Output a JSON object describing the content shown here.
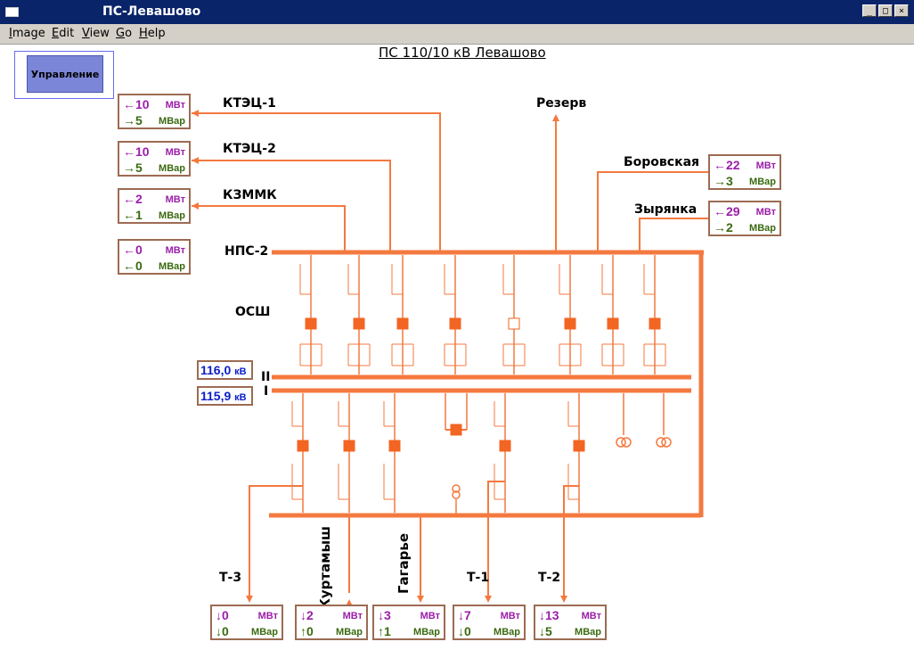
{
  "window": {
    "title": "ПС-Левашово"
  },
  "menu": [
    "Image",
    "Edit",
    "View",
    "Go",
    "Help"
  ],
  "control_button": "Управление",
  "page_title": "ПС 110/10 кВ Левашово",
  "labels": {
    "ktec1": "КТЭЦ-1",
    "ktec2": "КТЭЦ-2",
    "kzmmk": "КЗММК",
    "nps2": "НПС-2",
    "osh": "ОСШ",
    "rezerv": "Резерв",
    "borovskaya": "Боровская",
    "zyryanka": "Зырянка",
    "bus2": "II",
    "bus1": "I",
    "t3": "Т-3",
    "kurtamysh": "Куртамыш",
    "gagarye": "Гагарье",
    "t1": "Т-1",
    "t2": "Т-2"
  },
  "units": {
    "mw": "МВт",
    "mvar": "МВар",
    "kv": "кВ"
  },
  "voltages": {
    "bus2": "116,0",
    "bus1": "115,9"
  },
  "power": {
    "ktec1": {
      "p_arrow": "←",
      "p": "10",
      "q_arrow": "→",
      "q": "5"
    },
    "ktec2": {
      "p_arrow": "←",
      "p": "10",
      "q_arrow": "→",
      "q": "5"
    },
    "kzmmk": {
      "p_arrow": "←",
      "p": "2",
      "q_arrow": "←",
      "q": "1"
    },
    "nps2": {
      "p_arrow": "←",
      "p": "0",
      "q_arrow": "←",
      "q": "0"
    },
    "borovskaya": {
      "p_arrow": "←",
      "p": "22",
      "q_arrow": "→",
      "q": "3"
    },
    "zyryanka": {
      "p_arrow": "←",
      "p": "29",
      "q_arrow": "→",
      "q": "2"
    },
    "t3": {
      "p_arrow": "↓",
      "p": "0",
      "q_arrow": "↓",
      "q": "0"
    },
    "kurtamysh": {
      "p_arrow": "↓",
      "p": "2",
      "q_arrow": "↑",
      "q": "0"
    },
    "gagarye": {
      "p_arrow": "↓",
      "p": "3",
      "q_arrow": "↑",
      "q": "1"
    },
    "t1": {
      "p_arrow": "↓",
      "p": "7",
      "q_arrow": "↓",
      "q": "0"
    },
    "t2": {
      "p_arrow": "↓",
      "p": "13",
      "q_arrow": "↓",
      "q": "5"
    }
  },
  "colors": {
    "line": "#f4793f",
    "breaker": "#f26522",
    "titlebar": "#0a246a",
    "p_text": "#9a1ea8",
    "q_text": "#3a6a10",
    "kv_text": "#0c1ec8"
  }
}
